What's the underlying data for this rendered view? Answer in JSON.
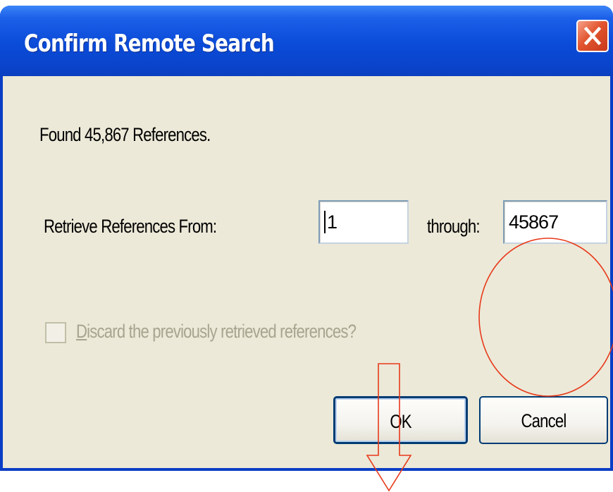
{
  "window": {
    "title": "Confirm Remote Search",
    "close_symbol": "X"
  },
  "message": "Found 45,867 References.",
  "range": {
    "label": "Retrieve References From:",
    "from_value": "1",
    "through_label": "through:",
    "to_value": "45867"
  },
  "discard_option": {
    "label": "Discard the previously retrieved references?",
    "checked": false,
    "enabled": false
  },
  "buttons": {
    "ok": "OK",
    "cancel": "Cancel"
  },
  "annotations": {
    "color": "#e8391a",
    "circle": "circle-highlight",
    "arrow": "down-arrow"
  },
  "colors": {
    "title_bar": "#0a44cc",
    "dialog_face": "#ece9d8",
    "close_button": "#e2552f"
  }
}
